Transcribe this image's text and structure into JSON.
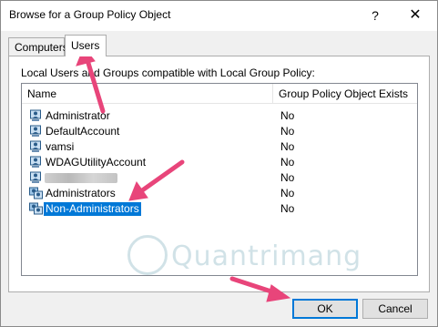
{
  "window": {
    "title": "Browse for a Group Policy Object",
    "help": "?",
    "close": "✕"
  },
  "tabs": [
    {
      "label": "Computers"
    },
    {
      "label": "Users"
    }
  ],
  "panel": {
    "label": "Local Users and Groups compatible with Local Group Policy:",
    "columns": {
      "name": "Name",
      "gpo": "Group Policy Object Exists"
    },
    "rows": [
      {
        "name": "Administrator",
        "value": "No",
        "icon": "user-icon"
      },
      {
        "name": "DefaultAccount",
        "value": "No",
        "icon": "user-icon"
      },
      {
        "name": "vamsi",
        "value": "No",
        "icon": "user-icon"
      },
      {
        "name": "WDAGUtilityAccount",
        "value": "No",
        "icon": "user-icon"
      },
      {
        "name": "",
        "value": "No",
        "icon": "user-icon"
      },
      {
        "name": "Administrators",
        "value": "No",
        "icon": "group-icon"
      },
      {
        "name": "Non-Administrators",
        "value": "No",
        "icon": "group-icon",
        "selected": true
      }
    ]
  },
  "buttons": {
    "ok": "OK",
    "cancel": "Cancel"
  },
  "watermark": {
    "text": "Quantrimang"
  },
  "colors": {
    "selection": "#0078d7",
    "arrow": "#e8457a",
    "client_bg": "#f0f0f0"
  }
}
